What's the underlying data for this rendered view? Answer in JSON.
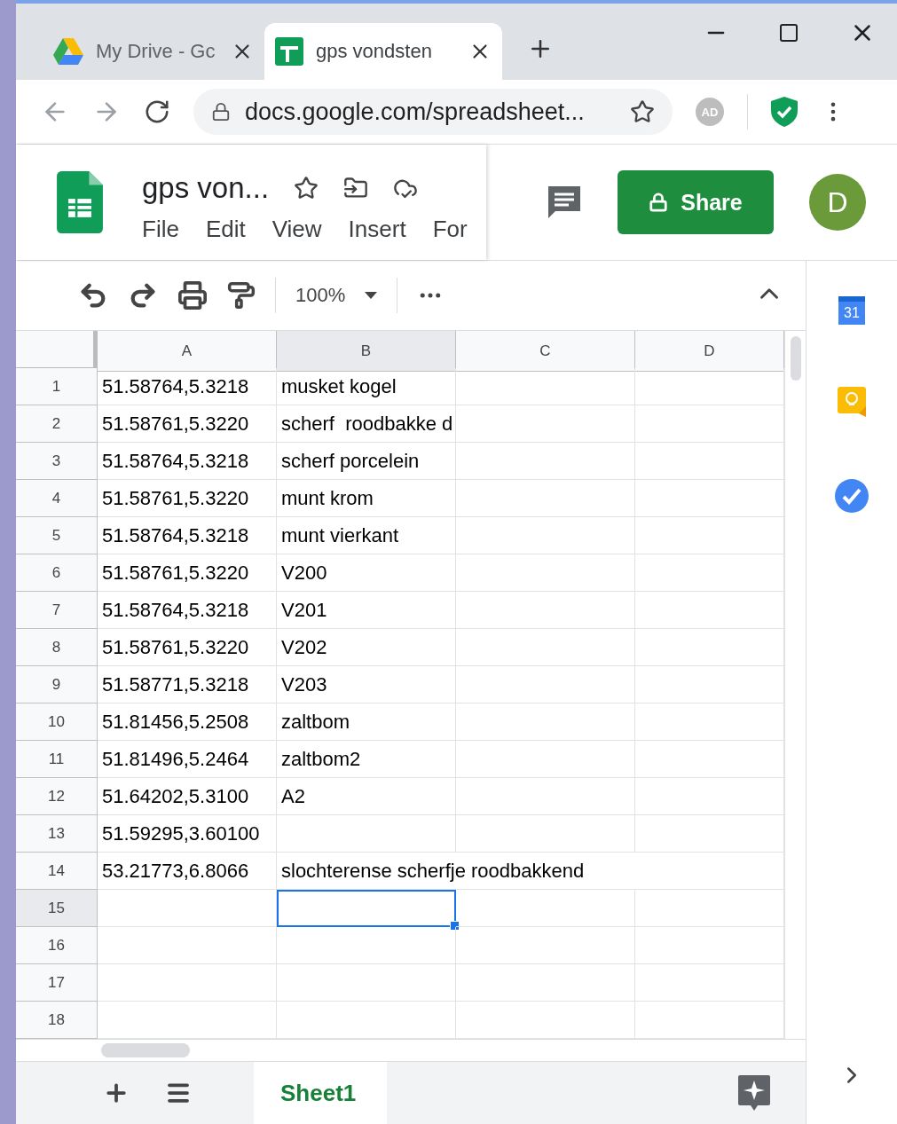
{
  "browser": {
    "tabs": [
      {
        "title": "My Drive - Gc",
        "selected": false
      },
      {
        "title": "gps vondsten",
        "selected": true
      }
    ],
    "url": "docs.google.com/spreadsheet...",
    "extension_badge": "AD"
  },
  "document": {
    "title": "gps von...",
    "menu": [
      "File",
      "Edit",
      "View",
      "Insert",
      "For"
    ],
    "share_label": "Share",
    "avatar_letter": "D"
  },
  "toolbar": {
    "zoom": "100%"
  },
  "side_panel": {
    "calendar_day": "31"
  },
  "sheet": {
    "columns": [
      {
        "label": "A"
      },
      {
        "label": "B"
      },
      {
        "label": "C"
      },
      {
        "label": "D"
      }
    ],
    "rows": [
      {
        "number": "1",
        "cells": [
          {
            "text": "51.58764,5.3218",
            "selected": false
          },
          {
            "text": "musket kogel",
            "selected": false
          },
          {
            "selected": false
          },
          {
            "selected": false
          }
        ]
      },
      {
        "number": "2",
        "cells": [
          {
            "text": "51.58761,5.3220",
            "selected": false
          },
          {
            "text": "scherf  roodbakke d",
            "selected": false
          },
          {
            "selected": false
          },
          {
            "selected": false
          }
        ]
      },
      {
        "number": "3",
        "cells": [
          {
            "text": "51.58764,5.3218",
            "selected": false
          },
          {
            "text": "scherf porcelein",
            "selected": false
          },
          {
            "selected": false
          },
          {
            "selected": false
          }
        ]
      },
      {
        "number": "4",
        "cells": [
          {
            "text": "51.58761,5.3220",
            "selected": false
          },
          {
            "text": "munt krom",
            "selected": false
          },
          {
            "selected": false
          },
          {
            "selected": false
          }
        ]
      },
      {
        "number": "5",
        "cells": [
          {
            "text": "51.58764,5.3218",
            "selected": false
          },
          {
            "text": "munt vierkant",
            "selected": false
          },
          {
            "selected": false
          },
          {
            "selected": false
          }
        ]
      },
      {
        "number": "6",
        "cells": [
          {
            "text": "51.58761,5.3220",
            "selected": false
          },
          {
            "text": "V200",
            "selected": false
          },
          {
            "selected": false
          },
          {
            "selected": false
          }
        ]
      },
      {
        "number": "7",
        "cells": [
          {
            "text": "51.58764,5.3218",
            "selected": false
          },
          {
            "text": "V201",
            "selected": false
          },
          {
            "selected": false
          },
          {
            "selected": false
          }
        ]
      },
      {
        "number": "8",
        "cells": [
          {
            "text": "51.58761,5.3220",
            "selected": false
          },
          {
            "text": "V202",
            "selected": false
          },
          {
            "selected": false
          },
          {
            "selected": false
          }
        ]
      },
      {
        "number": "9",
        "cells": [
          {
            "text": "51.58771,5.3218",
            "selected": false
          },
          {
            "text": "V203",
            "selected": false
          },
          {
            "selected": false
          },
          {
            "selected": false
          }
        ]
      },
      {
        "number": "10",
        "cells": [
          {
            "text": "51.81456,5.2508",
            "selected": false
          },
          {
            "text": "zaltbom",
            "selected": false
          },
          {
            "selected": false
          },
          {
            "selected": false
          }
        ]
      },
      {
        "number": "11",
        "cells": [
          {
            "text": "51.81496,5.2464",
            "selected": false
          },
          {
            "text": "zaltbom2",
            "selected": false
          },
          {
            "selected": false
          },
          {
            "selected": false
          }
        ]
      },
      {
        "number": "12",
        "cells": [
          {
            "text": "51.64202,5.3100",
            "selected": false
          },
          {
            "text": "A2",
            "selected": false
          },
          {
            "selected": false
          },
          {
            "selected": false
          }
        ]
      },
      {
        "number": "13",
        "cells": [
          {
            "text": "51.59295,3.60100",
            "selected": false
          },
          {
            "selected": false
          },
          {
            "selected": false
          },
          {
            "selected": false
          }
        ]
      },
      {
        "number": "14",
        "cells": [
          {
            "text": "53.21773,6.8066",
            "selected": false
          },
          {
            "text": "slochterense scherfje roodbakkend",
            "selected": false
          },
          {
            "selected": false
          },
          {
            "selected": false
          }
        ]
      },
      {
        "number": "15",
        "cells": [
          {
            "selected": false
          },
          {
            "selected": true
          },
          {
            "selected": false
          },
          {
            "selected": false
          }
        ]
      },
      {
        "number": "16",
        "cells": [
          {
            "selected": false
          },
          {
            "selected": false
          },
          {
            "selected": false
          },
          {
            "selected": false
          }
        ]
      },
      {
        "number": "17",
        "cells": [
          {
            "selected": false
          },
          {
            "selected": false
          },
          {
            "selected": false
          },
          {
            "selected": false
          }
        ]
      },
      {
        "number": "18",
        "cells": [
          {
            "selected": false
          },
          {
            "selected": false
          },
          {
            "selected": false
          },
          {
            "selected": false
          }
        ]
      }
    ],
    "sheet_tabs": [
      {
        "label": "Sheet1",
        "selected": true
      }
    ]
  }
}
